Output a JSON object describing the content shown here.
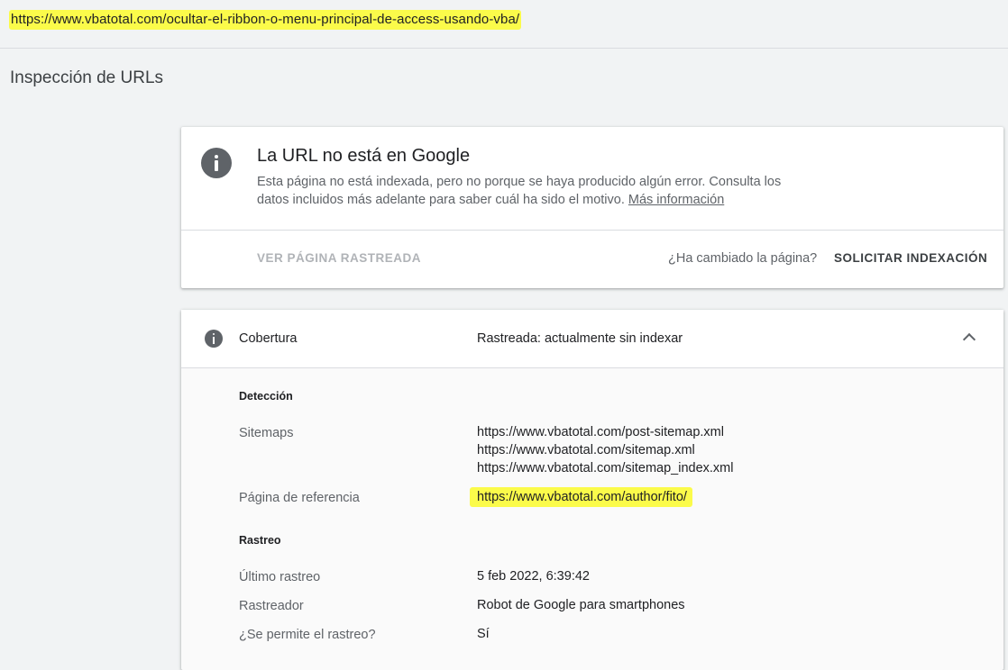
{
  "url_bar": {
    "url": "https://www.vbatotal.com/ocultar-el-ribbon-o-menu-principal-de-access-usando-vba/"
  },
  "page": {
    "title": "Inspección de URLs"
  },
  "status_card": {
    "icon": "info-icon",
    "title": "La URL no está en Google",
    "description": "Esta página no está indexada, pero no porque se haya producido algún error. Consulta los datos incluidos más adelante para saber cuál ha sido el motivo. ",
    "link_text": "Más información",
    "view_button": "VER PÁGINA RASTREADA",
    "changed_question": "¿Ha cambiado la página?",
    "request_button": "SOLICITAR INDEXACIÓN"
  },
  "coverage": {
    "icon": "info-icon",
    "label": "Cobertura",
    "value": "Rastreada: actualmente sin indexar",
    "toggle_icon": "chevron-up-icon",
    "detection": {
      "heading": "Detección",
      "sitemaps_label": "Sitemaps",
      "sitemaps": [
        "https://www.vbatotal.com/post-sitemap.xml",
        "https://www.vbatotal.com/sitemap.xml",
        "https://www.vbatotal.com/sitemap_index.xml"
      ],
      "referrer_label": "Página de referencia",
      "referrer": "https://www.vbatotal.com/author/fito/"
    },
    "crawl": {
      "heading": "Rastreo",
      "last_crawl_label": "Último rastreo",
      "last_crawl": "5 feb 2022, 6:39:42",
      "crawler_label": "Rastreador",
      "crawler": "Robot de Google para smartphones",
      "allowed_label": "¿Se permite el rastreo?",
      "allowed": "Sí"
    }
  },
  "colors": {
    "background": "#f1f3f4",
    "highlight": "#fbfb4a",
    "icon": "#5f6368"
  }
}
